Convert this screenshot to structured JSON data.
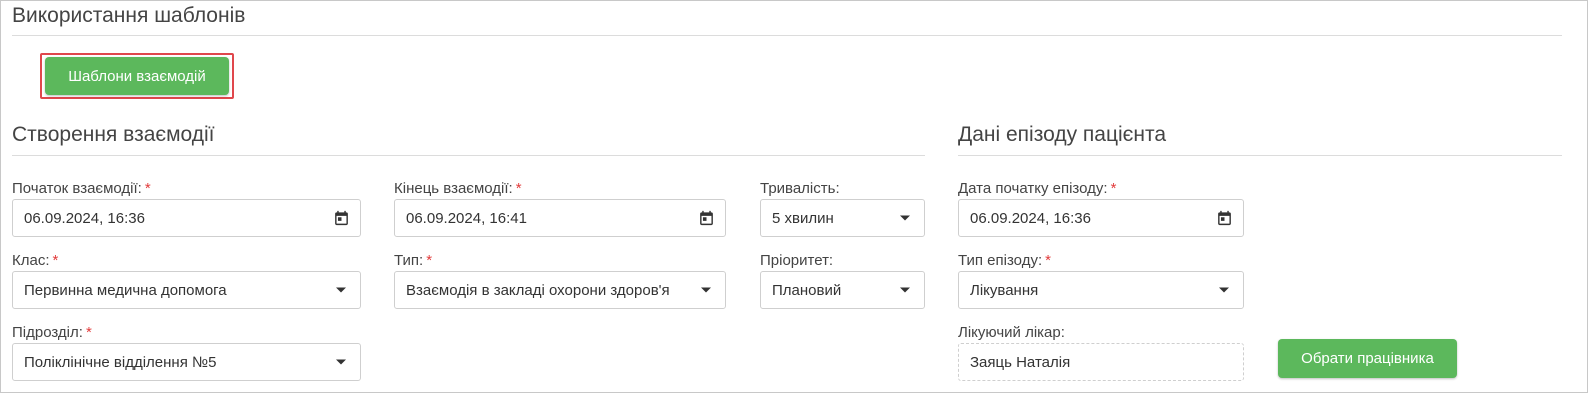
{
  "page": {
    "title": "Використання шаблонів",
    "templates_button": "Шаблони взаємодій"
  },
  "interaction": {
    "title": "Створення взаємодії",
    "start_label": "Початок взаємодії:",
    "start_value": "06.09.2024, 16:36",
    "end_label": "Кінець взаємодії:",
    "end_value": "06.09.2024, 16:41",
    "duration_label": "Тривалість:",
    "duration_value": "5 хвилин",
    "class_label": "Клас:",
    "class_value": "Первинна медична допомога",
    "type_label": "Тип:",
    "type_value": "Взаємодія в закладі охорони здоров'я",
    "priority_label": "Пріоритет:",
    "priority_value": "Плановий",
    "division_label": "Підрозділ:",
    "division_value": "Поліклінічне відділення №5",
    "required_mark": "*"
  },
  "episode": {
    "title": "Дані епізоду пацієнта",
    "start_label": "Дата початку епізоду:",
    "start_value": "06.09.2024, 16:36",
    "type_label": "Тип епізоду:",
    "type_value": "Лікування",
    "doctor_label": "Лікуючий лікар:",
    "doctor_value": "Заяць Наталія",
    "choose_button": "Обрати працівника"
  },
  "icons": {
    "calendar": "calendar-icon",
    "dropdown": "caret-down-icon"
  },
  "colors": {
    "button_green": "#5cb85c",
    "required_red": "#e23b3b",
    "highlight_border": "#e0474c"
  }
}
